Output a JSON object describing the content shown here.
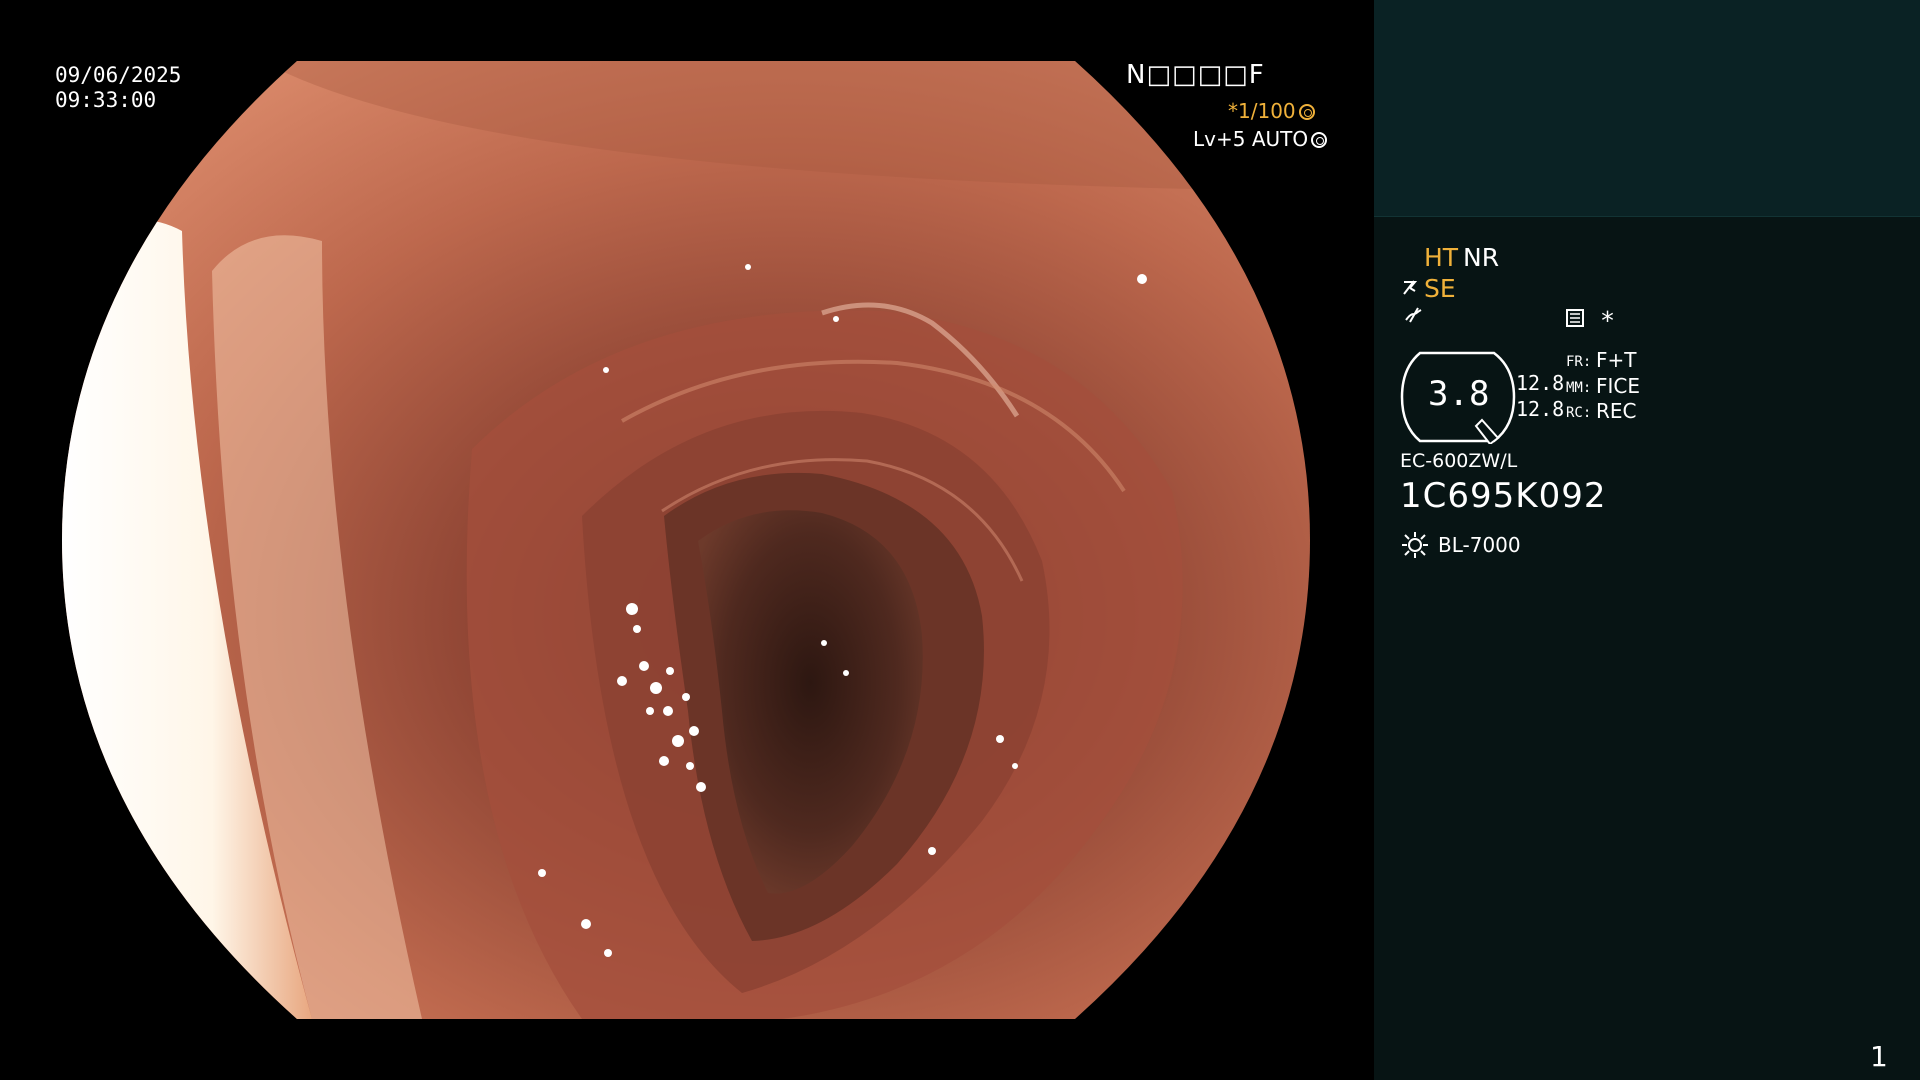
{
  "overlay": {
    "date": "09/06/2025",
    "time": "09:33:00",
    "patient_code": "N□□□□F",
    "shutter": "*1/100",
    "level": "Lv+5 AUTO"
  },
  "status_panel": {
    "ht": "HT",
    "nr": "NR",
    "se": "SE",
    "asterisk": "*",
    "gauge_value": "3.8",
    "gauge_left": "12.8",
    "gauge_left_2": "12.8",
    "fr_label": "FR:",
    "fr_value": "F+T",
    "mm_label": "MM:",
    "mm_value": "FICE",
    "rc_label": "RC:",
    "rc_value": "REC",
    "scope_model": "EC-600ZW/L",
    "serial": "1C695K092",
    "light_source": "BL-7000",
    "page_number": "1"
  },
  "icons": {
    "shutter_icon": "aperture-icon",
    "level_icon": "aperture-icon",
    "se_icon": "scope-tip-icon",
    "chart_icon": "waveform-icon",
    "menu_icon": "settings-list-icon",
    "light_icon": "sun-icon"
  },
  "colors": {
    "accent_orange": "#f0b13a",
    "panel_top": "#0a2224",
    "panel_bottom": "#071414",
    "tissue": "#b3604a"
  }
}
